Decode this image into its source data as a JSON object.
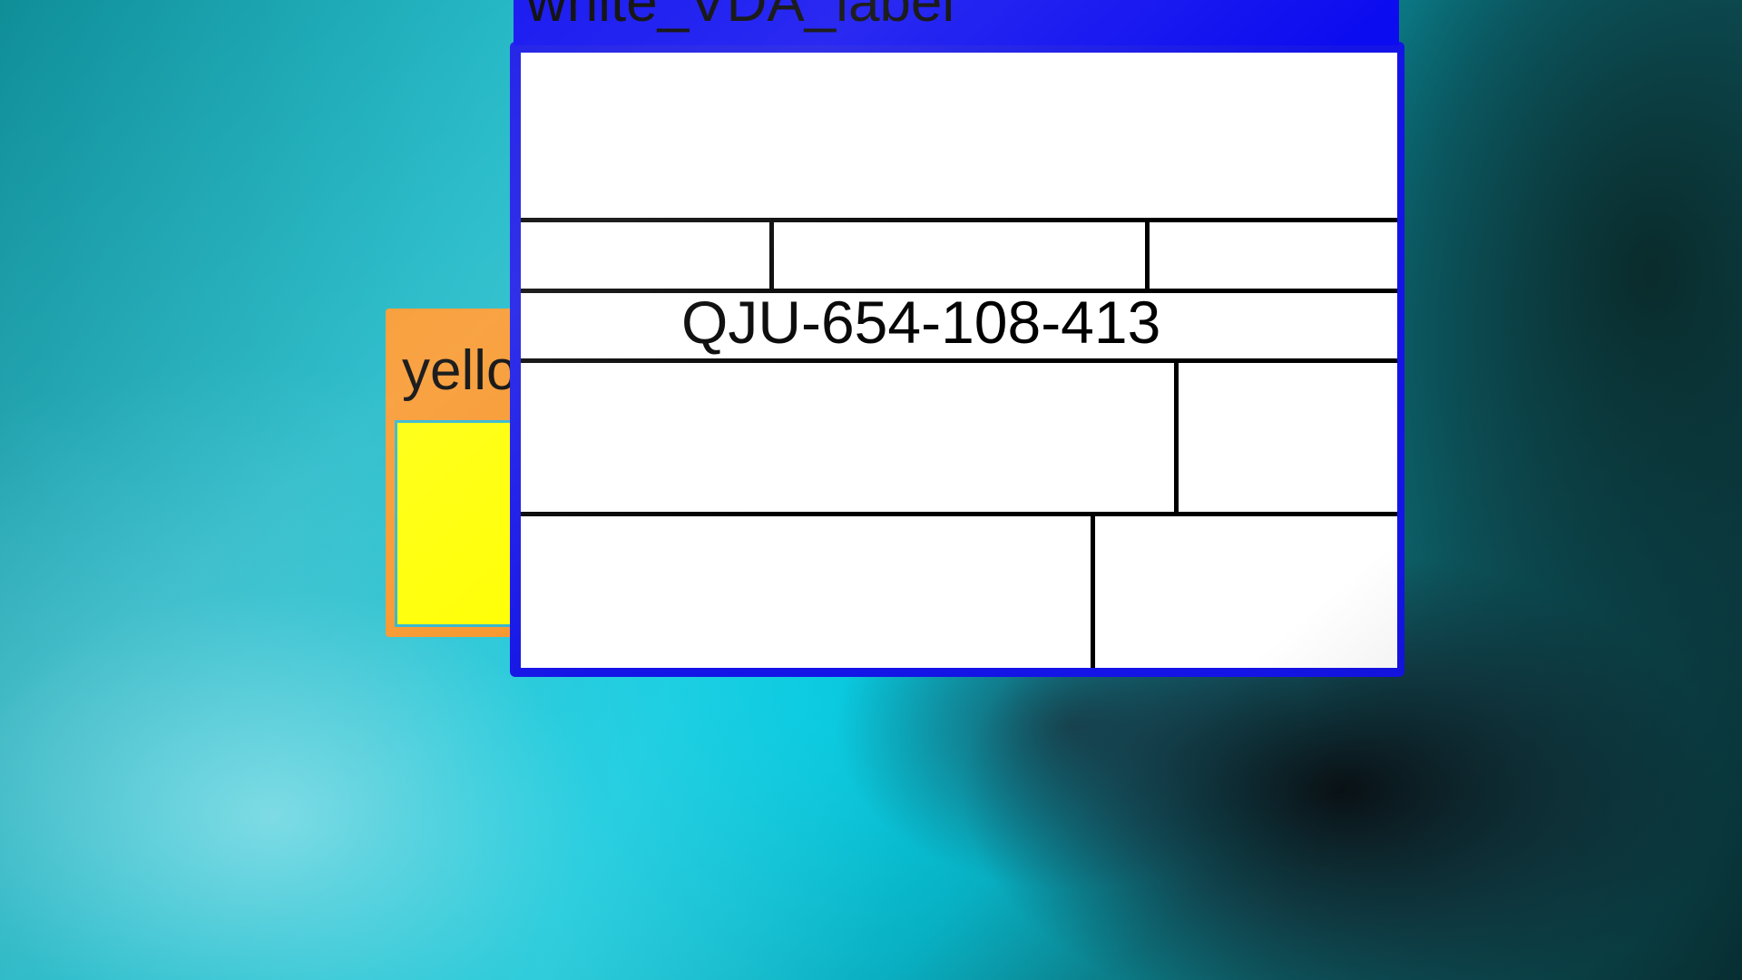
{
  "windows": {
    "yellow": {
      "title": "yello",
      "title_color": "#f7962a",
      "body_color": "#ffff00"
    },
    "label": {
      "title": "white_VDA_label",
      "frame_color": "#1414e6",
      "code": "QJU-654-108-413"
    }
  }
}
